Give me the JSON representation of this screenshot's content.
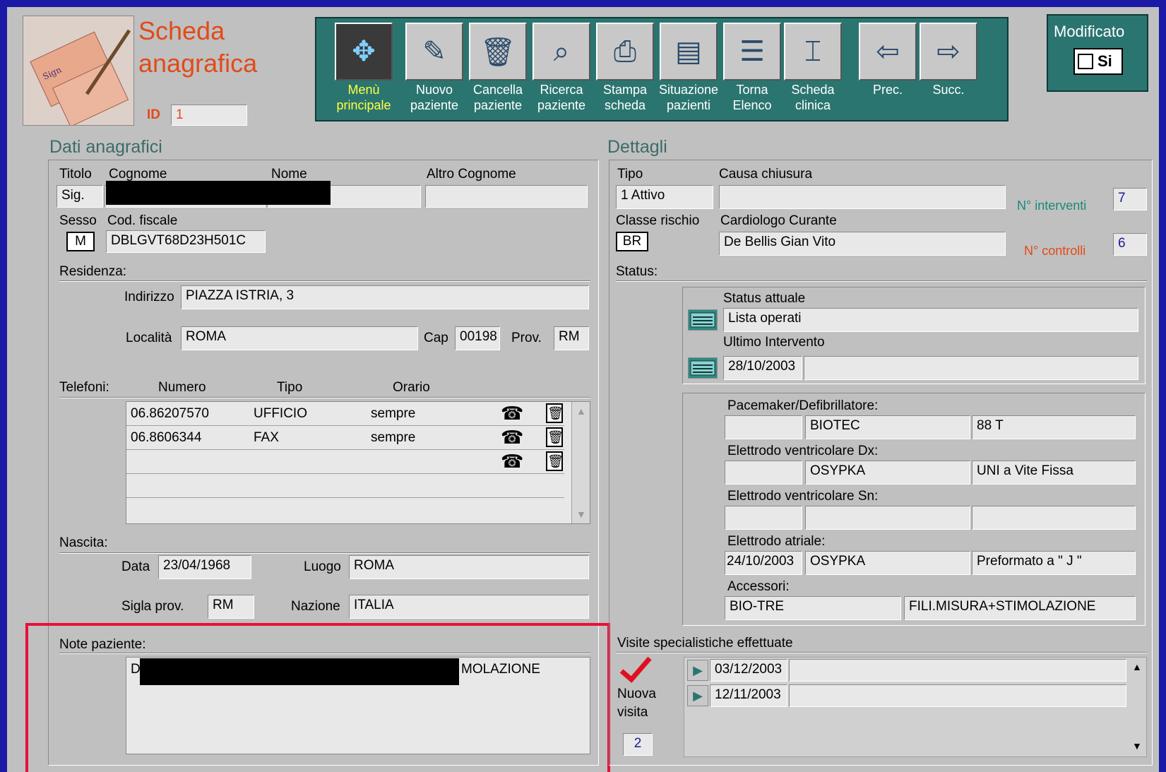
{
  "header": {
    "title_line1": "Scheda",
    "title_line2": "anagrafica",
    "id_label": "ID",
    "id_value": "1"
  },
  "toolbar": [
    {
      "label": "Menù\nprincipale",
      "icon": "menu-arrows-icon",
      "active": true
    },
    {
      "label": "Nuovo\npaziente",
      "icon": "new-patient-pencil-icon"
    },
    {
      "label": "Cancella\npaziente",
      "icon": "delete-patient-trash-icon"
    },
    {
      "label": "Ricerca\npaziente",
      "icon": "search-patient-icon"
    },
    {
      "label": "Stampa\nscheda",
      "icon": "print-icon"
    },
    {
      "label": "Situazione\npazienti",
      "icon": "patients-list-icon"
    },
    {
      "label": "Torna\nElenco",
      "icon": "list-icon"
    },
    {
      "label": "Scheda\nclinica",
      "icon": "clinical-card-icon"
    },
    {
      "label": "Prec.",
      "icon": "arrow-left-icon"
    },
    {
      "label": "Succ.",
      "icon": "arrow-right-icon"
    }
  ],
  "modified": {
    "title": "Modificato",
    "checkbox_label": "Si"
  },
  "anagrafici": {
    "section_title": "Dati anagrafici",
    "titolo_label": "Titolo",
    "cognome_label": "Cognome",
    "nome_label": "Nome",
    "altro_cognome_label": "Altro Cognome",
    "titolo_value": "Sig.",
    "sesso_label": "Sesso",
    "codfisc_label": "Cod. fiscale",
    "sesso_value": "M",
    "codfisc_value": "DBLGVT68D23H501C",
    "residenza_label": "Residenza:",
    "indirizzo_label": "Indirizzo",
    "indirizzo_value": "PIAZZA ISTRIA, 3",
    "localita_label": "Località",
    "localita_value": "ROMA",
    "cap_label": "Cap",
    "cap_value": "00198",
    "prov_label": "Prov.",
    "prov_value": "RM",
    "telefoni_label": "Telefoni:",
    "tel_col_numero": "Numero",
    "tel_col_tipo": "Tipo",
    "tel_col_orario": "Orario",
    "telefoni": [
      {
        "numero": "06.86207570",
        "tipo": "UFFICIO",
        "orario": "sempre"
      },
      {
        "numero": "06.8606344",
        "tipo": "FAX",
        "orario": "sempre"
      }
    ],
    "nascita_label": "Nascita:",
    "data_label": "Data",
    "data_value": "23/04/1968",
    "luogo_label": "Luogo",
    "luogo_value": "ROMA",
    "sigla_label": "Sigla prov.",
    "sigla_value": "RM",
    "nazione_label": "Nazione",
    "nazione_value": "ITALIA",
    "note_label": "Note paziente:",
    "note_prefix": "D",
    "note_suffix": "MOLAZIONE"
  },
  "dettagli": {
    "section_title": "Dettagli",
    "tipo_label": "Tipo",
    "tipo_value": "1 Attivo",
    "causa_label": "Causa chiusura",
    "n_interventi_label": "N° interventi",
    "n_interventi_value": "7",
    "classe_label": "Classe rischio",
    "classe_value": "BR",
    "cardiologo_label": "Cardiologo Curante",
    "cardiologo_value": "De Bellis  Gian Vito",
    "n_controlli_label": "N° controlli",
    "n_controlli_value": "6",
    "status_label": "Status:",
    "status_attuale_label": "Status attuale",
    "status_attuale_value": "Lista operati",
    "ultimo_intervento_label": "Ultimo Intervento",
    "ultimo_intervento_value": "28/10/2003",
    "pacemaker_label": "Pacemaker/Defibrillatore:",
    "pacemaker_b": "BIOTEC",
    "pacemaker_c": "88 T",
    "elettrodo_dx_label": "Elettrodo ventricolare Dx:",
    "elettrodo_dx_b": "OSYPKA",
    "elettrodo_dx_c": "UNI a Vite Fissa",
    "elettrodo_sn_label": "Elettrodo ventricolare Sn:",
    "elettrodo_atriale_label": "Elettrodo atriale:",
    "elettrodo_atriale_a": "24/10/2003",
    "elettrodo_atriale_b": "OSYPKA",
    "elettrodo_atriale_c": "Preformato a \" J \"",
    "accessori_label": "Accessori:",
    "accessori_a": "BIO-TRE",
    "accessori_b": "FILI.MISURA+STIMOLAZIONE",
    "visite_label": "Visite specialistiche effettuate",
    "nuova_visita_label": "Nuova\nvisita",
    "visite": [
      "03/12/2003",
      "12/11/2003"
    ],
    "visite_count": "2"
  },
  "colors": {
    "teal": "#2b7570",
    "highlight_border": "#e8103a",
    "count_blue": "#1a1a9a"
  }
}
